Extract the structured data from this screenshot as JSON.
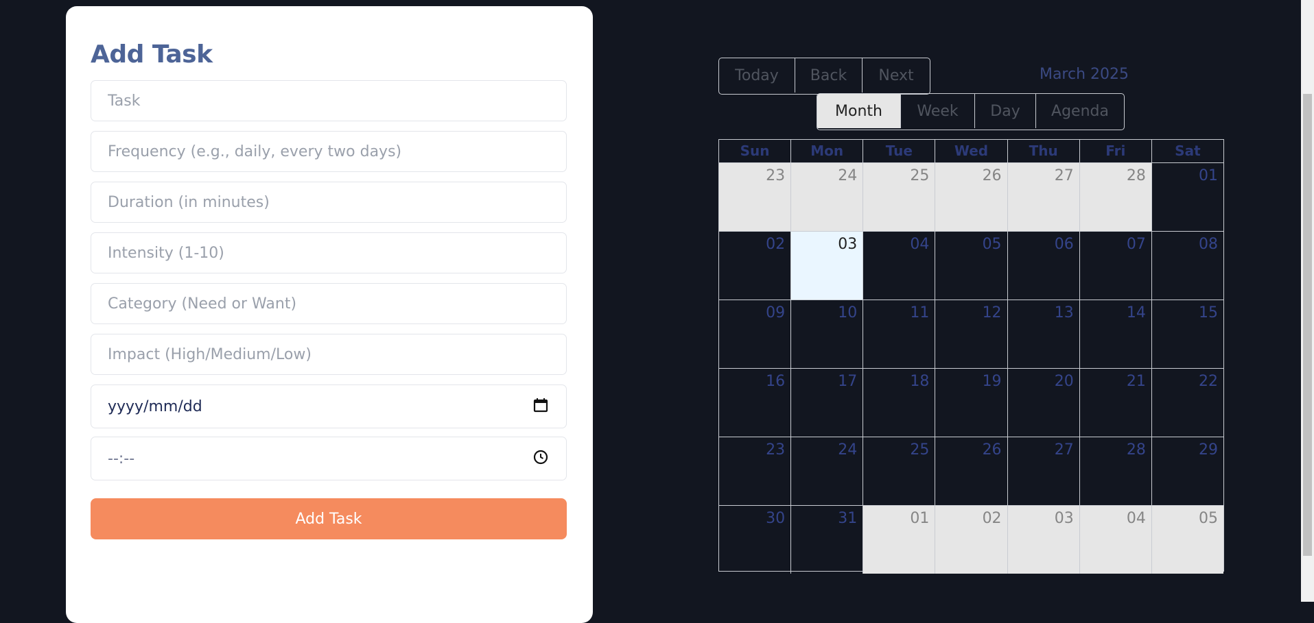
{
  "form": {
    "title": "Add Task",
    "fields": [
      {
        "name": "task-input",
        "placeholder": "Task"
      },
      {
        "name": "frequency-input",
        "placeholder": "Frequency (e.g., daily, every two days)"
      },
      {
        "name": "duration-input",
        "placeholder": "Duration (in minutes)"
      },
      {
        "name": "intensity-input",
        "placeholder": "Intensity (1-10)"
      },
      {
        "name": "category-input",
        "placeholder": "Category (Need or Want)"
      },
      {
        "name": "impact-input",
        "placeholder": "Impact (High/Medium/Low)"
      }
    ],
    "date_value": "yyyy/mm/dd",
    "time_value": "--:--",
    "date_icon": "calendar-icon",
    "time_icon": "clock-icon",
    "submit_label": "Add Task",
    "submit_color": "#f58b5e"
  },
  "calendar": {
    "nav": {
      "today": "Today",
      "back": "Back",
      "next": "Next"
    },
    "label": "March 2025",
    "views": {
      "month": "Month",
      "week": "Week",
      "day": "Day",
      "agenda": "Agenda"
    },
    "active_view": "Month",
    "weekdays": [
      "Sun",
      "Mon",
      "Tue",
      "Wed",
      "Thu",
      "Fri",
      "Sat"
    ],
    "weeks": [
      [
        {
          "d": "23",
          "off": true
        },
        {
          "d": "24",
          "off": true
        },
        {
          "d": "25",
          "off": true
        },
        {
          "d": "26",
          "off": true
        },
        {
          "d": "27",
          "off": true
        },
        {
          "d": "28",
          "off": true
        },
        {
          "d": "01"
        }
      ],
      [
        {
          "d": "02"
        },
        {
          "d": "03",
          "today": true
        },
        {
          "d": "04"
        },
        {
          "d": "05"
        },
        {
          "d": "06"
        },
        {
          "d": "07"
        },
        {
          "d": "08"
        }
      ],
      [
        {
          "d": "09"
        },
        {
          "d": "10"
        },
        {
          "d": "11"
        },
        {
          "d": "12"
        },
        {
          "d": "13"
        },
        {
          "d": "14"
        },
        {
          "d": "15"
        }
      ],
      [
        {
          "d": "16"
        },
        {
          "d": "17"
        },
        {
          "d": "18"
        },
        {
          "d": "19"
        },
        {
          "d": "20"
        },
        {
          "d": "21"
        },
        {
          "d": "22"
        }
      ],
      [
        {
          "d": "23"
        },
        {
          "d": "24"
        },
        {
          "d": "25"
        },
        {
          "d": "26"
        },
        {
          "d": "27"
        },
        {
          "d": "28"
        },
        {
          "d": "29"
        }
      ],
      [
        {
          "d": "30"
        },
        {
          "d": "31"
        },
        {
          "d": "01",
          "off": true
        },
        {
          "d": "02",
          "off": true
        },
        {
          "d": "03",
          "off": true
        },
        {
          "d": "04",
          "off": true
        },
        {
          "d": "05",
          "off": true
        }
      ]
    ]
  }
}
